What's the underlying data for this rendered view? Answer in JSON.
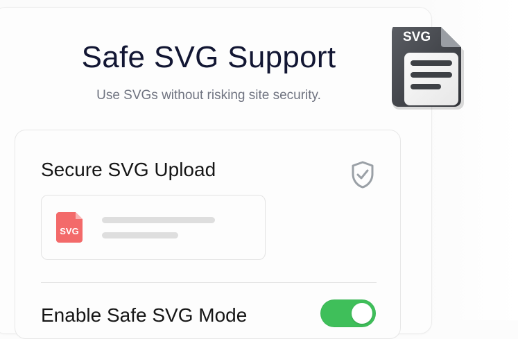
{
  "header": {
    "title": "Safe SVG Support",
    "subtitle": "Use SVGs without risking site security."
  },
  "upload": {
    "title": "Secure SVG Upload",
    "file_badge": "SVG",
    "shield_icon": "shield-check-icon"
  },
  "toggle": {
    "label": "Enable Safe SVG Mode",
    "state": "on"
  },
  "hero_icon": {
    "label": "SVG",
    "icon_name": "svg-document-icon"
  },
  "colors": {
    "accent_green": "#3fbf5a",
    "file_red": "#f36a6a",
    "title_text": "#121633",
    "muted_text": "#6f7380"
  }
}
